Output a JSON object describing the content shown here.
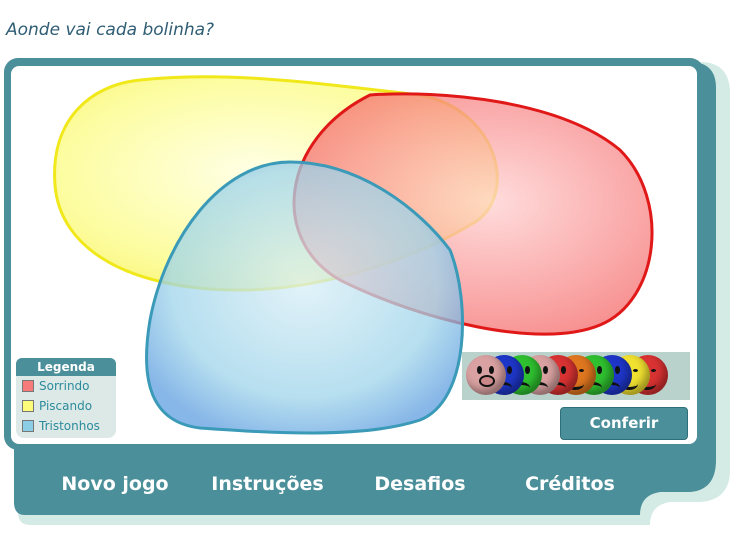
{
  "title": "Aonde vai cada bolinha?",
  "legend": {
    "heading": "Legenda",
    "items": [
      {
        "label": "Sorrindo",
        "color": "#f77b7b"
      },
      {
        "label": "Piscando",
        "color": "#fcfc7a"
      },
      {
        "label": "Tristonhos",
        "color": "#8ccde6"
      }
    ]
  },
  "sets": [
    {
      "name": "sorrindo-region",
      "color": "#f77b7b"
    },
    {
      "name": "piscando-region",
      "color": "#fcfc7a"
    },
    {
      "name": "tristonhos-region",
      "color": "#8ccde6"
    }
  ],
  "balls": [
    {
      "color": "#d9a1a1",
      "face": "pig"
    },
    {
      "color": "#1e36c8",
      "face": "sad"
    },
    {
      "color": "#2fc02f",
      "face": "sad"
    },
    {
      "color": "#d9a1a1",
      "face": "sad"
    },
    {
      "color": "#d93232",
      "face": "sad"
    },
    {
      "color": "#e0771f",
      "face": "smile"
    },
    {
      "color": "#2fc02f",
      "face": "sad"
    },
    {
      "color": "#1e36c8",
      "face": "sad"
    },
    {
      "color": "#f0e030",
      "face": "smile"
    },
    {
      "color": "#d93232",
      "face": "smile"
    }
  ],
  "buttons": {
    "check": "Conferir",
    "new_game": "Novo jogo",
    "instructions": "Instruções",
    "challenges": "Desafios",
    "credits": "Créditos"
  },
  "colors": {
    "frame": "#4a8f99",
    "frame_shadow": "#d4eae4"
  }
}
